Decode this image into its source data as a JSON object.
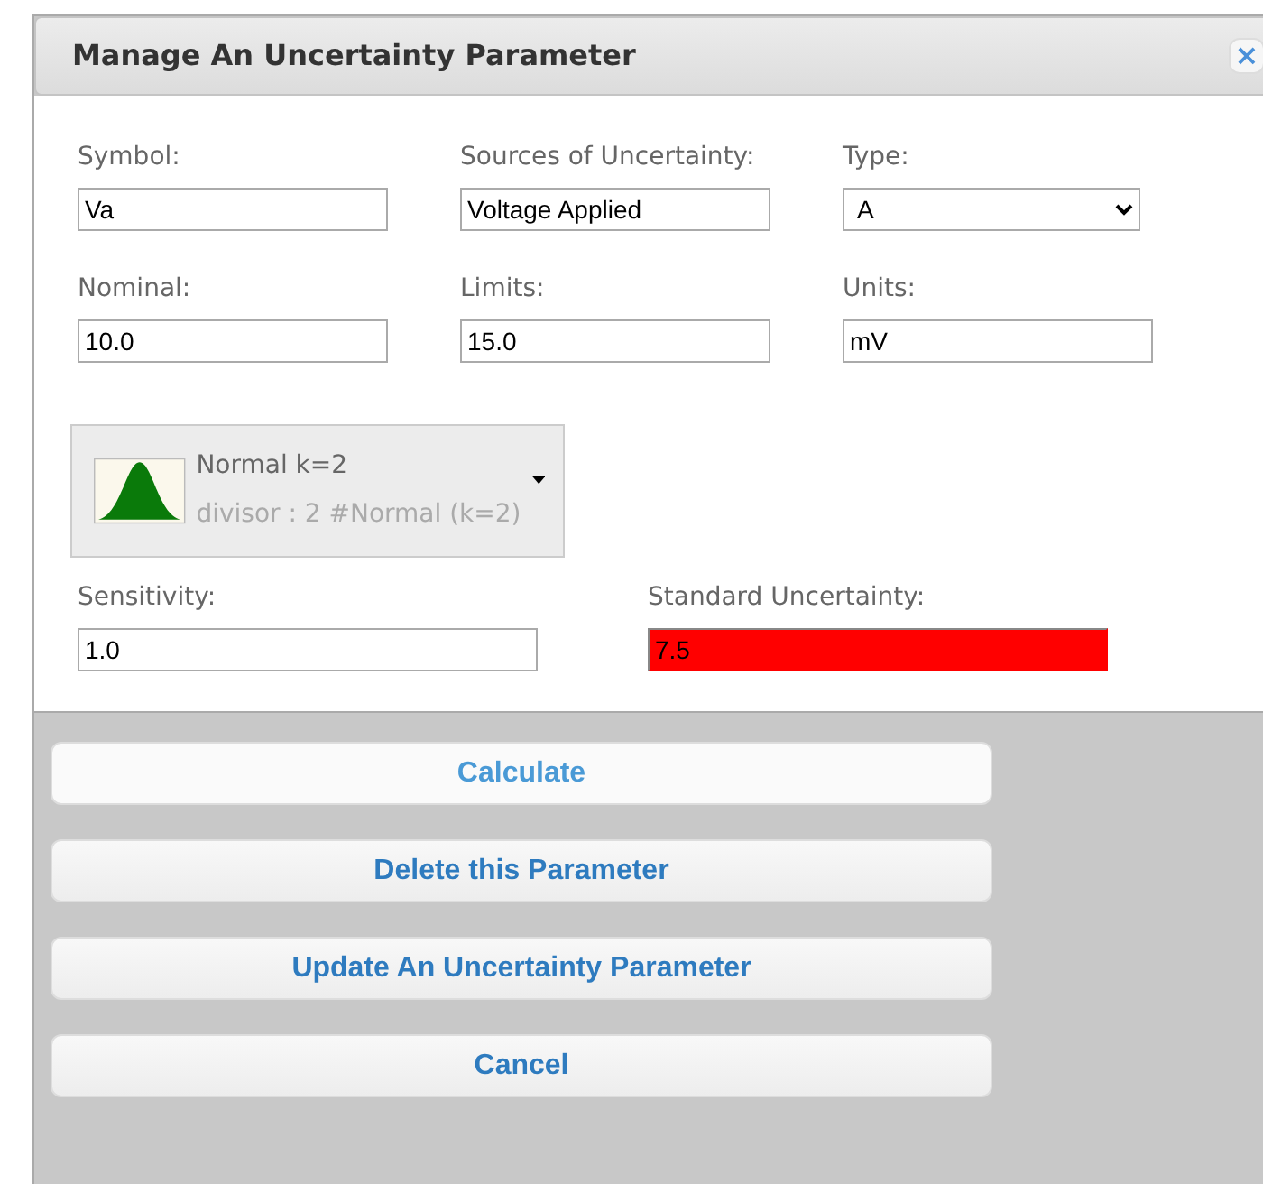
{
  "dialog": {
    "title": "Manage An Uncertainty Parameter",
    "close_icon": "×"
  },
  "fields": [
    {
      "label": "Symbol:",
      "kind": "text",
      "value": "Va"
    },
    {
      "label": "Sources of Uncertainty:",
      "kind": "text",
      "value": "Voltage Applied"
    },
    {
      "label": "Type:",
      "kind": "select",
      "value": "A"
    },
    {
      "label": "Nominal:",
      "kind": "text",
      "value": "10.0"
    },
    {
      "label": "Limits:",
      "kind": "text",
      "value": "15.0"
    },
    {
      "label": "Units:",
      "kind": "text",
      "value": "mV"
    }
  ],
  "distribution": {
    "name": "Normal k=2",
    "detail": "divisor : 2 #Normal (k=2)"
  },
  "results": [
    {
      "label": "Sensitivity:",
      "value": "1.0",
      "error": false
    },
    {
      "label": "Standard Uncertainty:",
      "value": "7.5",
      "error": true
    }
  ],
  "buttons": [
    {
      "label": "Calculate",
      "highlighted": true
    },
    {
      "label": "Delete this Parameter",
      "highlighted": false
    },
    {
      "label": "Update An Uncertainty Parameter",
      "highlighted": false
    },
    {
      "label": "Cancel",
      "highlighted": false
    }
  ]
}
